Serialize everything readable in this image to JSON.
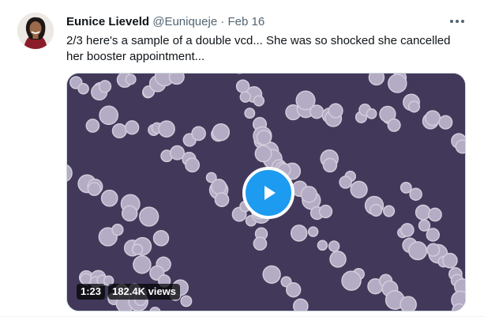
{
  "tweet": {
    "author_name": "Eunice Lieveld",
    "handle": "@Euniqueje",
    "separator": "·",
    "date": "Feb 16",
    "text": "2/3 here's a sample of a double vcd... She was so shocked she cancelled her booster appointment...",
    "more_icon": "more-horizontal-icon"
  },
  "video": {
    "duration": "1:23",
    "views": "182.4K views",
    "play_icon": "play-icon"
  },
  "colors": {
    "accent": "#1d9bf0",
    "secondary_text": "#536471",
    "primary_text": "#0f1419"
  }
}
